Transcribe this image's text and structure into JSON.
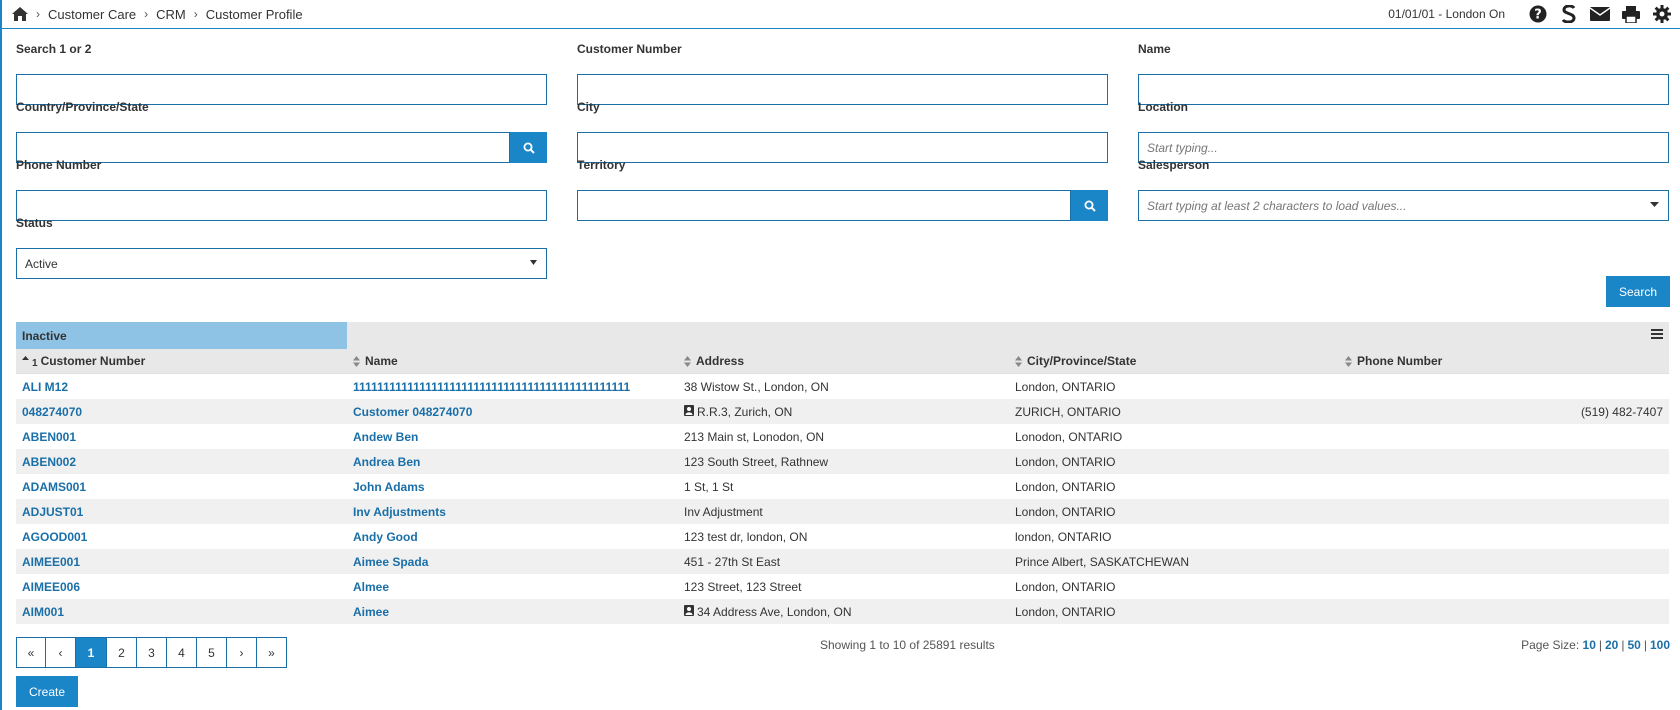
{
  "breadcrumb": {
    "items": [
      "Customer Care",
      "CRM",
      "Customer Profile"
    ],
    "separator": "›"
  },
  "header": {
    "session": "01/01/01 - London On",
    "icons": [
      "help-icon",
      "s-logo-icon",
      "mail-icon",
      "print-icon",
      "gear-icon"
    ]
  },
  "form": {
    "search12": {
      "label": "Search 1 or 2",
      "value": ""
    },
    "customer_number": {
      "label": "Customer Number",
      "value": ""
    },
    "name": {
      "label": "Name",
      "value": ""
    },
    "country": {
      "label": "Country/Province/State",
      "value": ""
    },
    "city": {
      "label": "City",
      "value": ""
    },
    "location": {
      "label": "Location",
      "placeholder": "Start typing..."
    },
    "phone": {
      "label": "Phone Number",
      "value": ""
    },
    "territory": {
      "label": "Territory",
      "value": ""
    },
    "salesperson": {
      "label": "Salesperson",
      "placeholder": "Start typing at least 2 characters to load values..."
    },
    "status": {
      "label": "Status",
      "value": "Active"
    },
    "search_label": "Search"
  },
  "grid": {
    "group_label": "Inactive",
    "columns": [
      "Customer Number",
      "Name",
      "Address",
      "City/Province/State",
      "Phone Number"
    ],
    "sorted_column_marker": "1",
    "rows": [
      {
        "number": "ALI M12",
        "name": "1111111111111111111111111111111111111111111111",
        "address": "38 Wistow St., London, ON",
        "contact_icon": false,
        "city": "London, ONTARIO",
        "phone": ""
      },
      {
        "number": "048274070",
        "name": "Customer 048274070",
        "address": "R.R.3, Zurich, ON",
        "contact_icon": true,
        "city": "ZURICH, ONTARIO",
        "phone": "(519) 482-7407"
      },
      {
        "number": "ABEN001",
        "name": "Andew Ben",
        "address": "213 Main st, Lonodon, ON",
        "contact_icon": false,
        "city": "Lonodon, ONTARIO",
        "phone": ""
      },
      {
        "number": "ABEN002",
        "name": "Andrea Ben",
        "address": "123 South Street, Rathnew",
        "contact_icon": false,
        "city": "London, ONTARIO",
        "phone": ""
      },
      {
        "number": "ADAMS001",
        "name": "John Adams",
        "address": "1 St, 1 St",
        "contact_icon": false,
        "city": "London, ONTARIO",
        "phone": ""
      },
      {
        "number": "ADJUST01",
        "name": "Inv Adjustments",
        "address": "Inv Adjustment",
        "contact_icon": false,
        "city": "London, ONTARIO",
        "phone": ""
      },
      {
        "number": "AGOOD001",
        "name": "Andy Good",
        "address": "123 test dr, london, ON",
        "contact_icon": false,
        "city": "london, ONTARIO",
        "phone": ""
      },
      {
        "number": "AIMEE001",
        "name": "Aimee Spada",
        "address": "451 - 27th St East",
        "contact_icon": false,
        "city": "Prince Albert, SASKATCHEWAN",
        "phone": ""
      },
      {
        "number": "AIMEE006",
        "name": "Almee",
        "address": "123 Street, 123 Street",
        "contact_icon": false,
        "city": "London, ONTARIO",
        "phone": ""
      },
      {
        "number": "AIM001",
        "name": "Aimee",
        "address": "34 Address Ave, London, ON",
        "contact_icon": true,
        "city": "London, ONTARIO",
        "phone": ""
      }
    ]
  },
  "pagination": {
    "buttons": [
      "«",
      "‹",
      "1",
      "2",
      "3",
      "4",
      "5",
      "›",
      "»"
    ],
    "current": "1",
    "showing": "Showing 1 to 10 of 25891 results",
    "page_size_label": "Page Size:",
    "page_sizes": [
      "10",
      "20",
      "50",
      "100"
    ]
  },
  "create_label": "Create",
  "colors": {
    "accent": "#1a86c8",
    "group_bar": "#8fc3e6",
    "link": "#1a6fa8"
  }
}
